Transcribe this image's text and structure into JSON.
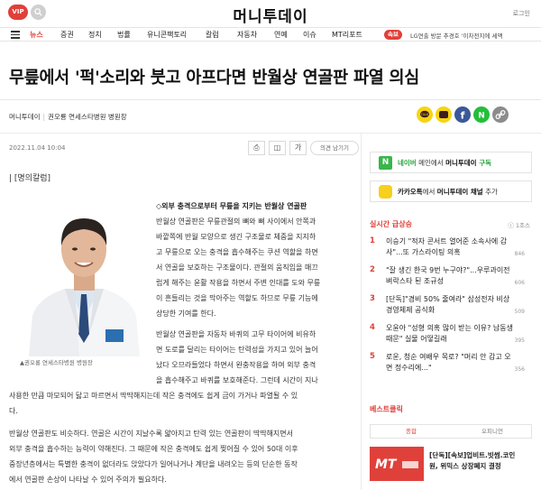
{
  "header": {
    "vip": "VIP",
    "logo": "머니투데이",
    "login": "로그인"
  },
  "nav": {
    "items": [
      "뉴스",
      "증권",
      "정치",
      "법률",
      "유니콘팩토리",
      "칼럼",
      "자동차",
      "연예",
      "이슈",
      "MT리포트"
    ],
    "active_index": 0,
    "ticker_badge": "속보",
    "ticker_text": "LG연출 방문 추경호 '이차전지에 세액"
  },
  "article": {
    "headline": "무릎에서 '퍽'소리와 붓고 아프다면 반월상 연골판 파열 의심",
    "byline_source": "머니투데이",
    "byline_author": "권오룡 연세스타병원 병원장",
    "date": "2022.11.04 10:04",
    "tools": {
      "print": "⎙",
      "bookmark": "◫",
      "font": "가",
      "comment": "의견 남기기"
    },
    "column_label": "| [명의칼럼]",
    "photo_caption": "▲권오룡 연세스타병원 병원장",
    "para1_title": "◇외부 충격으로부터 무릎을 지키는 반월상 연골판",
    "para1_lines": [
      "반월상 연골판은 무릎관절의 뼈와 뼈 사이에서 안쪽과",
      "바깥쪽에 반월 모양으로 생긴 구조물로 체중을 지지하",
      "고 무릎으로 오는 충격을 흡수해주는 쿠션 역할을 하면",
      "서 연골을 보호하는 구조물이다. 관절의 움직임을 매끄",
      "럽게 해주는 윤활 작용을 하면서 주변 인대를 도와 무릎",
      "이 흔들리는 것을 막아주는 역할도 하므로 무릎 기능에",
      "상당한 기여를 한다."
    ],
    "para2_lines": [
      "반월상 연골판을 자동차 바퀴의 고무 타이어에 비유하",
      "면 도로를 달리는 타이어는 탄력성을 가지고 있어 늘어",
      "났다 오므라들었다 하면서 완충작용을 하여 외부 충격",
      "을 흡수해주고 바퀴를 보호해준다. 그런데 시간이 지나",
      "사용한 만큼 마모되어 닳고 마르면서 딱딱해지는데 작은 충격에도 쉽게 금이 가거나 파열될 수 있",
      "다."
    ],
    "para3_lines": [
      "반월상 연골판도 비슷하다. 연골은 시간이 지날수록 얇아지고 탄력 있는 연골판이 딱딱해지면서",
      "외부 충격을 흡수하는 능력이 약해진다. 그 때문에 작은 충격에도 쉽게 찢어질 수 있어 50대 이후",
      "중장년층에서는 특별한 충격이 없더라도 앉았다가 일어나거나 계단을 내려오는 등의 단순한 동작",
      "에서 연골판 손상이 나타날 수 있어 주의가 필요하다."
    ]
  },
  "sidebar": {
    "naver_box": {
      "brand": "N",
      "pre": "네이버",
      "mid": " 메인에서 ",
      "name": "머니투데이",
      "post": " 구독"
    },
    "kakao_box": {
      "pre": "카카오톡",
      "mid": "에서 ",
      "name": "머니투데이 채널",
      "post": " 추가"
    },
    "realtime_title": "실시간 급상승",
    "realtime_meta": "ⓘ 1조스",
    "ranks": [
      {
        "num": "1",
        "line1": "이승기 \"적자 콘서트 열어준 소속사에 감",
        "line2": "사\"...또 가스라이팅 의혹",
        "count": "846"
      },
      {
        "num": "2",
        "line1": "\"잘 생긴 한국 9번 누구야?\"...우루과이전",
        "line2": "벼락스타 된 조규성",
        "count": "606"
      },
      {
        "num": "3",
        "line1": "[단독]\"경비 50% 줄여라\" 삼성전자 비상",
        "line2": "경영체제 공식화",
        "count": "509"
      },
      {
        "num": "4",
        "line1": "오윤아 \"성형 의혹 많이 받는 이유? 남동생",
        "line2": "때문\" 실물 어떻길래",
        "count": "395"
      },
      {
        "num": "5",
        "line1": "로운, 청순 여배우 목로? \"머리 안 감고 오",
        "line2": "면 정수리에...\"",
        "count": "356"
      }
    ],
    "best_title": "베스트클릭",
    "tabs": [
      "종합",
      "오피니언"
    ],
    "promo_line1": "[단독][속보]업비트.빗썸.코인",
    "promo_line2": "원, 위믹스 상장폐지 결정",
    "colors": {
      "accent": "#e0403a",
      "naver": "#38b64a",
      "kakao": "#f6d01b"
    }
  },
  "share_icons": [
    "kakaotalk-icon",
    "kakaostory-icon",
    "facebook-icon",
    "naver-icon",
    "link-icon"
  ]
}
